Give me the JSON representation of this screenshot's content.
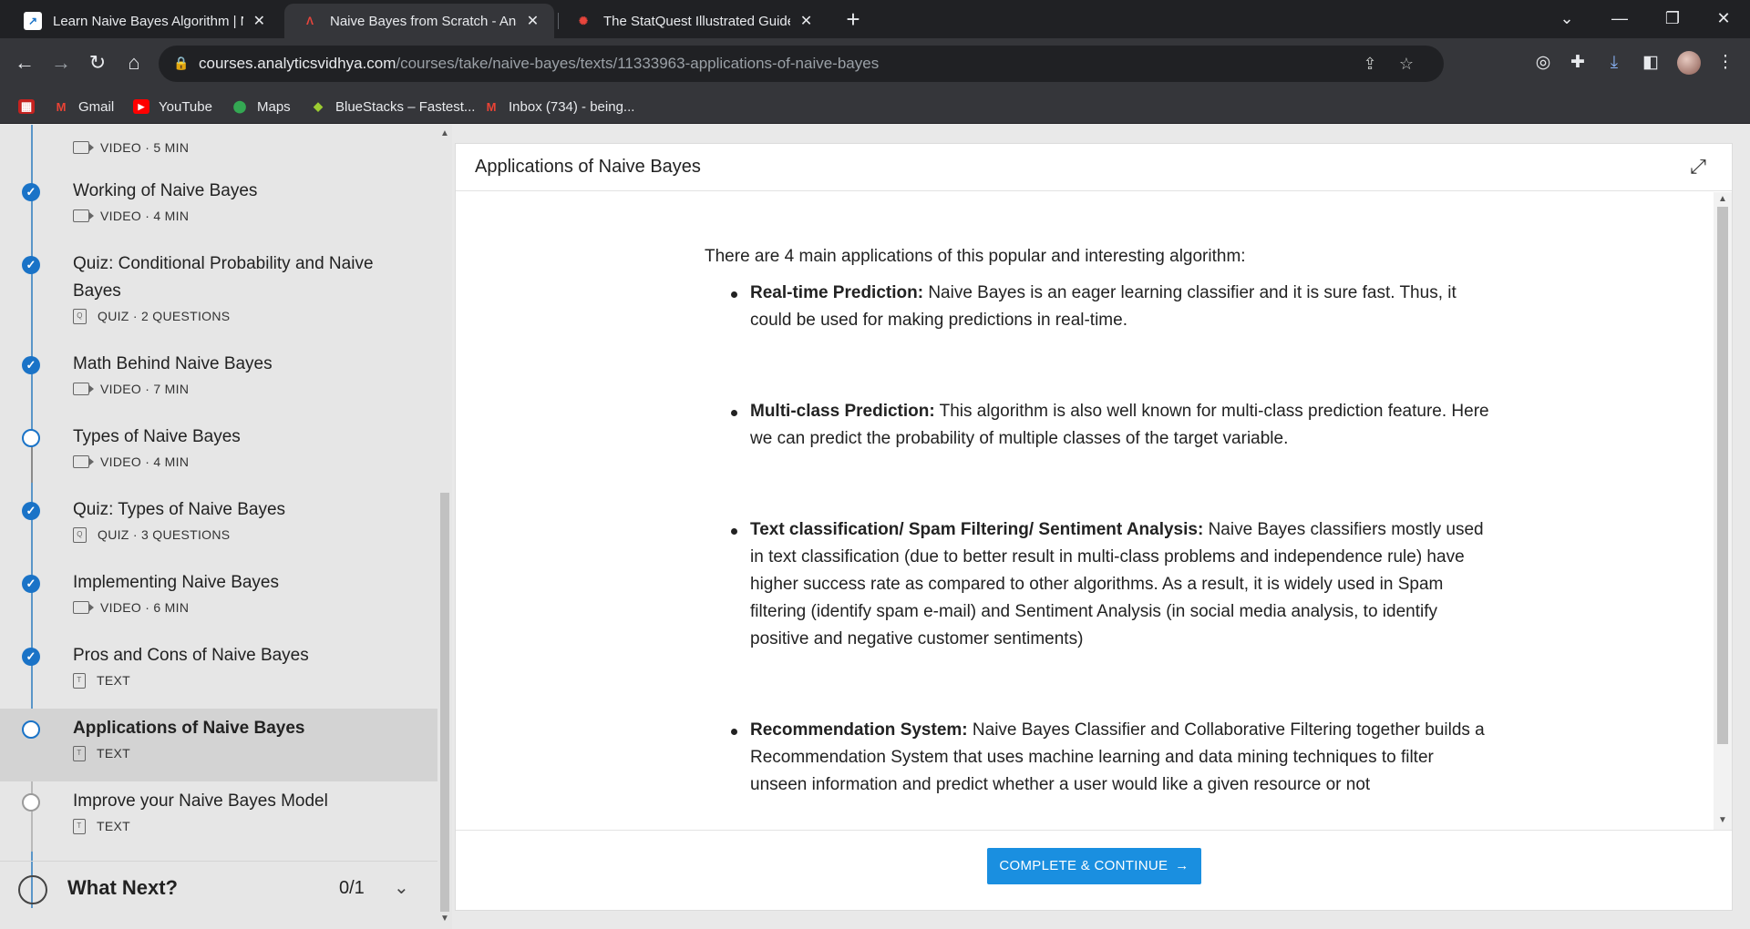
{
  "browser": {
    "tabs": [
      {
        "title": "Learn Naive Bayes Algorithm | N",
        "favicon": "analytics-chart-icon",
        "active": false
      },
      {
        "title": "Naive Bayes from Scratch - Anal",
        "favicon": "analytics-vidhya-icon",
        "active": true
      },
      {
        "title": "The StatQuest Illustrated Guide t",
        "favicon": "statquest-icon",
        "active": false
      }
    ],
    "url_domain": "courses.analyticsvidhya.com",
    "url_path": "/courses/take/naive-bayes/texts/11333963-applications-of-naive-bayes",
    "bookmarks": [
      {
        "label": "Gmail",
        "icon": "gmail-icon"
      },
      {
        "label": "YouTube",
        "icon": "youtube-icon"
      },
      {
        "label": "Maps",
        "icon": "maps-icon"
      },
      {
        "label": "BlueStacks – Fastest...",
        "icon": "bluestacks-icon"
      },
      {
        "label": "Inbox (734) - being...",
        "icon": "gmail-icon"
      }
    ]
  },
  "sidebar": {
    "partial_item_meta": "VIDEO · 5 MIN",
    "items": [
      {
        "title": "Working of Naive Bayes",
        "meta": "VIDEO · 4 MIN",
        "kind": "video",
        "status": "done"
      },
      {
        "title": "Quiz: Conditional Probability and Naive Bayes",
        "meta": "QUIZ · 2 QUESTIONS",
        "kind": "quiz",
        "status": "done"
      },
      {
        "title": "Math Behind Naive Bayes",
        "meta": "VIDEO · 7 MIN",
        "kind": "video",
        "status": "done"
      },
      {
        "title": "Types of Naive Bayes",
        "meta": "VIDEO · 4 MIN",
        "kind": "video",
        "status": "todo"
      },
      {
        "title": "Quiz: Types of Naive Bayes",
        "meta": "QUIZ · 3 QUESTIONS",
        "kind": "quiz",
        "status": "done"
      },
      {
        "title": "Implementing Naive Bayes",
        "meta": "VIDEO · 6 MIN",
        "kind": "video",
        "status": "done"
      },
      {
        "title": "Pros and Cons of Naive Bayes",
        "meta": "TEXT",
        "kind": "text",
        "status": "done"
      },
      {
        "title": "Applications of Naive Bayes",
        "meta": "TEXT",
        "kind": "text",
        "status": "current"
      },
      {
        "title": "Improve your Naive Bayes Model",
        "meta": "TEXT",
        "kind": "text",
        "status": "locked"
      }
    ],
    "what_next": {
      "label": "What Next?",
      "count": "0/1"
    }
  },
  "lesson": {
    "title": "Applications of Naive Bayes",
    "intro": "There are 4 main applications of this popular and interesting algorithm:",
    "bullets": [
      {
        "term": "Real-time Prediction:",
        "text": " Naive Bayes is an eager learning classifier and it is sure fast. Thus, it could be used for making predictions in real-time."
      },
      {
        "term": "Multi-class Prediction:",
        "text": " This algorithm is also well known for multi-class prediction feature. Here we can predict the probability of multiple classes of the target variable."
      },
      {
        "term": "Text classification/ Spam Filtering/ Sentiment Analysis:",
        "text": " Naive Bayes classifiers mostly used in text classification (due to better result in multi-class problems and independence rule) have higher success rate as compared to other algorithms. As a result, it is widely used in Spam filtering (identify spam e-mail) and Sentiment Analysis (in social media analysis, to identify positive and negative customer sentiments)"
      },
      {
        "term": "Recommendation System:",
        "text": " Naive Bayes Classifier and Collaborative Filtering together builds a Recommendation System that uses machine learning and data mining techniques to filter unseen information and predict whether a user would like a given resource or not"
      }
    ],
    "cta_label": "COMPLETE & CONTINUE"
  },
  "colors": {
    "accent": "#1a73c7",
    "cta": "#1a8fe0",
    "chrome_dark": "#202124",
    "chrome": "#35363a"
  }
}
